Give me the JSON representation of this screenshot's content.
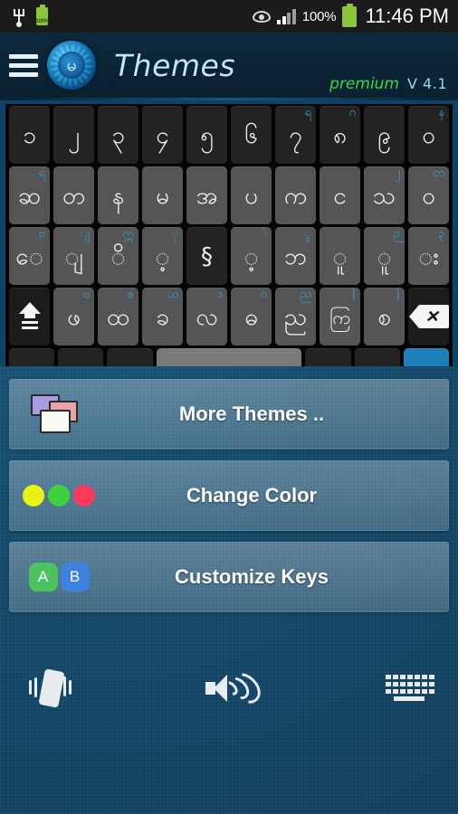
{
  "statusbar": {
    "usb_icon": "usb-icon",
    "battery_small_label": "100%",
    "eye_icon": "eye-icon",
    "signal_icon": "signal-bars-icon",
    "signal_percent": "100%",
    "battery_icon": "battery-icon",
    "clock": "11:46 PM"
  },
  "header": {
    "menu_icon": "hamburger-menu-icon",
    "logo_icon": "app-logo-icon",
    "logo_glyph": "မ",
    "title": "Themes",
    "premium_label": "premium",
    "version_label": "V 4.1"
  },
  "keyboard": {
    "rows": [
      {
        "style": "dark",
        "keys": [
          {
            "main": "၁",
            "sup": ""
          },
          {
            "main": "၂",
            "sup": ""
          },
          {
            "main": "၃",
            "sup": ""
          },
          {
            "main": "၄",
            "sup": ""
          },
          {
            "main": "၅",
            "sup": ""
          },
          {
            "main": "၆",
            "sup": ""
          },
          {
            "main": "၇",
            "sup": "ရ"
          },
          {
            "main": "၈",
            "sup": "ဂ"
          },
          {
            "main": "၉",
            "sup": ""
          },
          {
            "main": "၀",
            "sup": "န"
          }
        ]
      },
      {
        "style": "mid",
        "keys": [
          {
            "main": "ဆ",
            "sup": "ရ"
          },
          {
            "main": "တ",
            "sup": ""
          },
          {
            "main": "န",
            "sup": ""
          },
          {
            "main": "မ",
            "sup": ""
          },
          {
            "main": "အ",
            "sup": ""
          },
          {
            "main": "ပ",
            "sup": ""
          },
          {
            "main": "က",
            "sup": ""
          },
          {
            "main": "င",
            "sup": ""
          },
          {
            "main": "သ",
            "sup": "၂"
          },
          {
            "main": "ဝ",
            "sup": "တ"
          }
        ]
      },
      {
        "style": "mid",
        "keys": [
          {
            "main": "ေ",
            "sup": "ဗ"
          },
          {
            "main": "ျ",
            "sup": "ျ"
          },
          {
            "main": "ိ",
            "sup": "ဣ"
          },
          {
            "main": "့",
            "sup": "ု"
          },
          {
            "main": "§",
            "sup": "",
            "style": "dark"
          },
          {
            "main": "့",
            "sup": "ဲ"
          },
          {
            "main": "ဘ",
            "sup": "ွ"
          },
          {
            "main": "ူ",
            "sup": ""
          },
          {
            "main": "ူ",
            "sup": "ဉ"
          },
          {
            "main": "း",
            "sup": "၃"
          }
        ]
      },
      {
        "style": "mid",
        "keys": [
          {
            "main": "shift-icon",
            "sup": "",
            "style": "func",
            "icon": "shift-icon"
          },
          {
            "main": "ဖ",
            "sup": "ဗ"
          },
          {
            "main": "ထ",
            "sup": "ဇ"
          },
          {
            "main": "ခ",
            "sup": "ယ"
          },
          {
            "main": "လ",
            "sup": "ဒ"
          },
          {
            "main": "ဓ",
            "sup": "ဂ"
          },
          {
            "main": "ည",
            "sup": "ည"
          },
          {
            "main": "ကြ",
            "sup": "|"
          },
          {
            "main": "စ",
            "sup": "|"
          },
          {
            "main": "backspace-icon",
            "sup": "",
            "style": "func",
            "icon": "backspace-icon"
          }
        ]
      }
    ],
    "bottom_row_enter_icon": "enter-key"
  },
  "options": [
    {
      "id": "more-themes",
      "label": "More Themes ..",
      "icon": "themes-stack-icon"
    },
    {
      "id": "change-color",
      "label": "Change Color",
      "icon": "color-dots-icon",
      "dot_colors": [
        "#e9f215",
        "#3ed13e",
        "#fa3a5c"
      ]
    },
    {
      "id": "customize-keys",
      "label": "Customize Keys",
      "icon": "ab-keys-icon",
      "key_a": "A",
      "key_b": "B",
      "key_a_color": "#4cc360",
      "key_b_color": "#3d82e0"
    }
  ],
  "bottombar": {
    "vibrate_icon": "vibrate-icon",
    "sound_icon": "sound-icon",
    "keyboard_icon": "keyboard-icon"
  },
  "colors": {
    "background": "#134b6d",
    "header": "#0b2436",
    "accent_blue": "#1d7fb8",
    "premium_green": "#37d94a",
    "title_blue": "#bfe6f5"
  }
}
